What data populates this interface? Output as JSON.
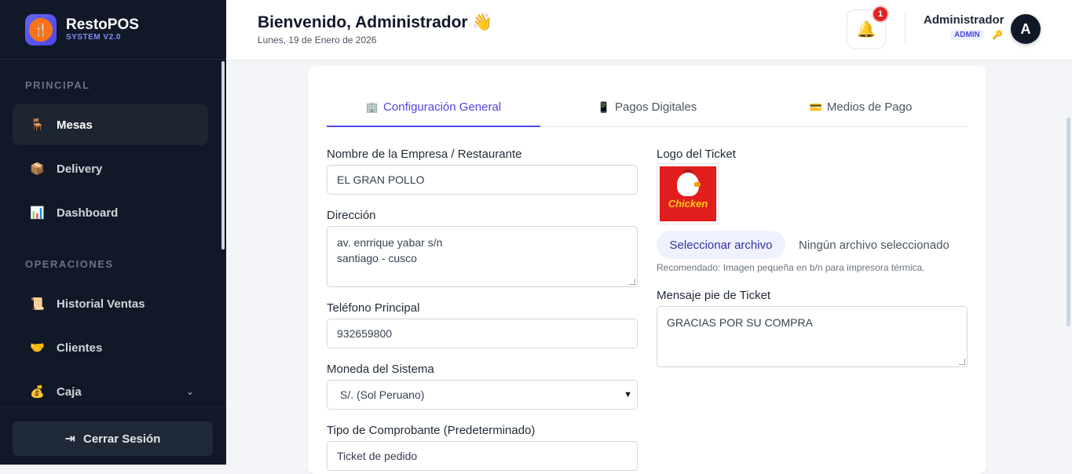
{
  "brand": {
    "name": "RestoPOS",
    "version": "SYSTEM V2.0"
  },
  "sidebar": {
    "sections": [
      {
        "label": "PRINCIPAL"
      },
      {
        "label": "OPERACIONES"
      }
    ],
    "items": [
      {
        "label": "Mesas",
        "icon": "chair-icon",
        "active": true
      },
      {
        "label": "Delivery",
        "icon": "package-icon"
      },
      {
        "label": "Dashboard",
        "icon": "chart-icon"
      },
      {
        "label": "Historial Ventas",
        "icon": "scroll-icon"
      },
      {
        "label": "Clientes",
        "icon": "handshake-icon"
      },
      {
        "label": "Caja",
        "icon": "money-bag-icon"
      }
    ],
    "logout_label": "Cerrar Sesión"
  },
  "header": {
    "welcome": "Bienvenido, Administrador 👋",
    "date": "Lunes, 19 de Enero de 2026",
    "notification_count": "1",
    "user_name": "Administrador",
    "user_role": "ADMIN",
    "avatar_initial": "A"
  },
  "tabs": [
    {
      "label": "Configuración General",
      "icon": "building-icon",
      "active": true
    },
    {
      "label": "Pagos Digitales",
      "icon": "phone-icon"
    },
    {
      "label": "Medios de Pago",
      "icon": "card-icon"
    }
  ],
  "form": {
    "company_label": "Nombre de la Empresa / Restaurante",
    "company_value": "EL GRAN POLLO",
    "address_label": "Dirección",
    "address_line1": "av. enrrique yabar s/n",
    "address_line2": "santiago - cusco",
    "phone_label": "Teléfono Principal",
    "phone_value": "932659800",
    "currency_label": "Moneda del Sistema",
    "currency_value": "S/. (Sol Peruano)",
    "receipt_label": "Tipo de Comprobante (Predeterminado)",
    "receipt_value": "Ticket de pedido",
    "logo_label": "Logo del Ticket",
    "logo_text": "Chicken",
    "file_button": "Seleccionar archivo",
    "file_none": "Ningún archivo seleccionado",
    "logo_hint": "Recomendado: Imagen pequeña en b/n para impresora térmica.",
    "footer_label": "Mensaje pie de Ticket",
    "footer_value": "GRACIAS POR SU COMPRA"
  }
}
